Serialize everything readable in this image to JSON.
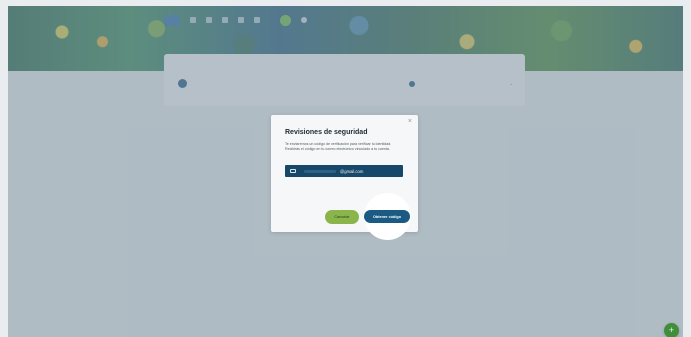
{
  "modal": {
    "title": "Revisiones de seguridad",
    "body": "Te enviaremos un código de verificación para verificar tu identidad. Recibirás el código en tu correo electrónico vinculado a tu cuenta.",
    "close_glyph": "×",
    "email_suffix": "@gmail.com",
    "cancel_label": "Cancelar",
    "primary_label": "Obtener código"
  },
  "fab": {
    "icon": "+"
  },
  "colors": {
    "primary": "#1b5a82",
    "cancel": "#8ab54a",
    "email_box": "#17486a",
    "fab": "#3f8e3a"
  }
}
